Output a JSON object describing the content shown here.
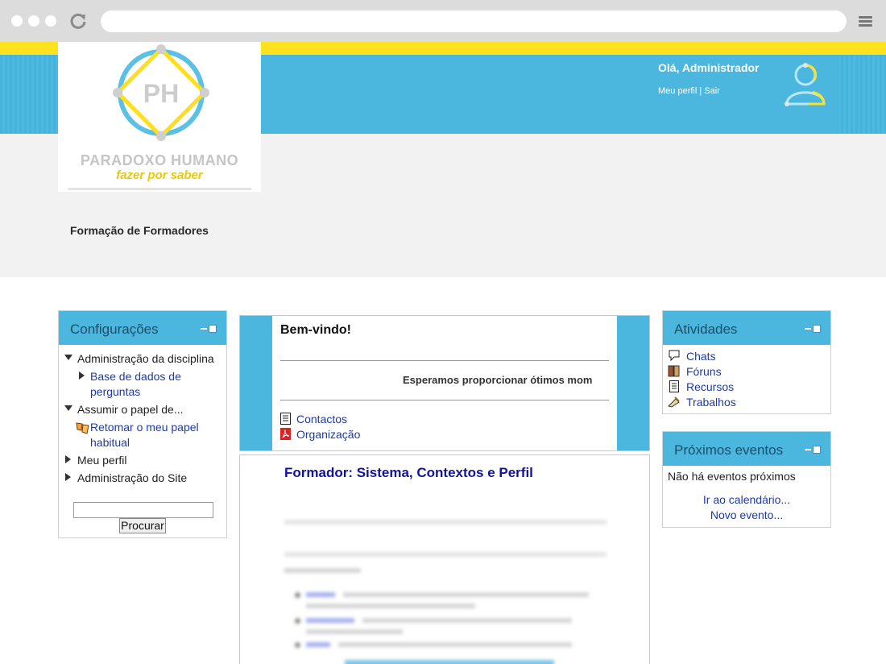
{
  "header": {
    "greeting": "Olá, Administrador",
    "profile_link": "Meu perfil",
    "separator": " | ",
    "logout_link": "Sair"
  },
  "logo": {
    "initials": "PH",
    "name": "PARADOXO HUMANO",
    "slogan": "fazer por saber"
  },
  "course": {
    "title": "Formação de Formadores"
  },
  "settings_block": {
    "title": "Configurações",
    "items": [
      {
        "label": "Administração da disciplina"
      },
      {
        "label": "Base de dados de"
      },
      {
        "label": "perguntas"
      },
      {
        "label": "Assumir o papel de..."
      },
      {
        "label": "Retomar o meu papel"
      },
      {
        "label": "habitual"
      },
      {
        "label": "Meu perfil"
      },
      {
        "label": "Administração do Site"
      }
    ],
    "search_value": "",
    "search_button": "Procurar"
  },
  "welcome": {
    "title": "Bem-vindo!",
    "text": "Esperamos proporcionar ótimos mom",
    "resources": [
      {
        "label": "Contactos",
        "icon": "document-icon"
      },
      {
        "label": "Organização",
        "icon": "pdf-icon"
      }
    ]
  },
  "section": {
    "title": "Formador: Sistema, Contextos e Perfil"
  },
  "activities_block": {
    "title": "Atividades",
    "items": [
      {
        "label": "Chats",
        "icon": "chat-icon"
      },
      {
        "label": "Fóruns",
        "icon": "forum-icon"
      },
      {
        "label": "Recursos",
        "icon": "resource-icon"
      },
      {
        "label": "Trabalhos",
        "icon": "assignment-icon"
      }
    ]
  },
  "events_block": {
    "title": "Próximos eventos",
    "empty_text": "Não há eventos próximos",
    "calendar_link": "Ir ao calendário...",
    "new_event_link": "Novo evento..."
  },
  "colors": {
    "header_blue": "#4bb6de",
    "header_yellow": "#ffe21f",
    "link": "#1d3aa8",
    "section_title": "#12129a"
  }
}
